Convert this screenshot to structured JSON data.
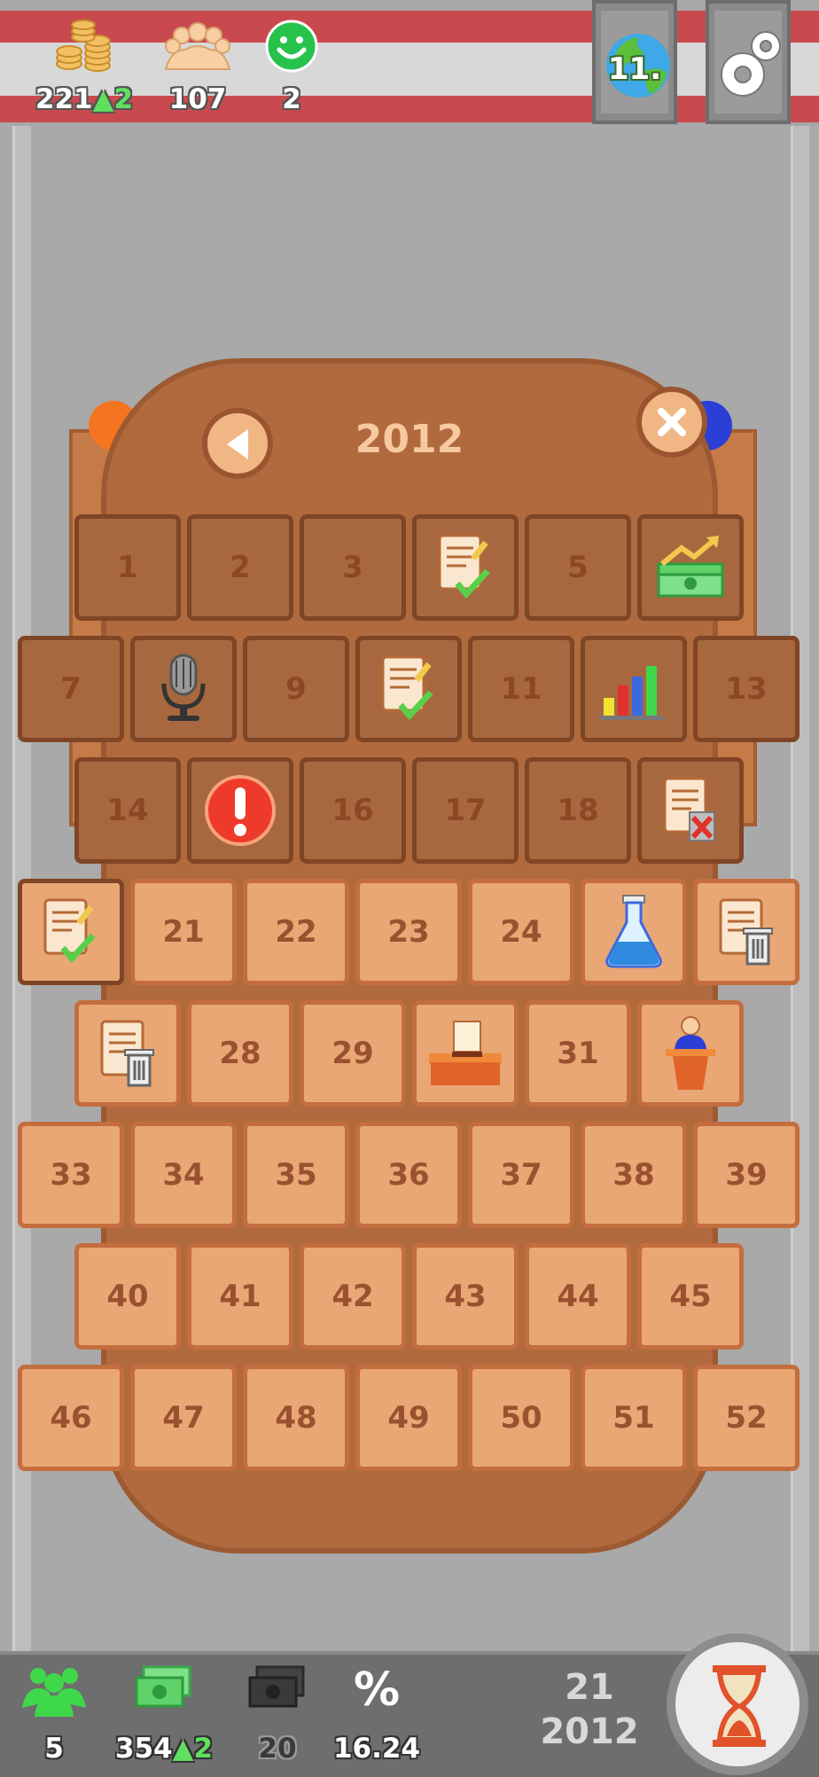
{
  "top_bar": {
    "coins": {
      "value": "221",
      "gain": "2"
    },
    "population": {
      "value": "107"
    },
    "happiness": {
      "value": "2"
    },
    "rank_label": "11.",
    "icons": {
      "coins": "coin-stack-icon",
      "population": "crowd-icon",
      "happiness": "smiley-icon",
      "rank": "globe-icon",
      "settings": "gears-icon"
    }
  },
  "calendar": {
    "year": "2012",
    "back_icon": "left-arrow-icon",
    "close_icon": "close-icon",
    "weeks": [
      {
        "label": "1",
        "state": "past",
        "icon": null
      },
      {
        "label": "2",
        "state": "past",
        "icon": null
      },
      {
        "label": "3",
        "state": "past",
        "icon": null
      },
      {
        "label": "",
        "state": "past",
        "icon": "document-approved-icon"
      },
      {
        "label": "5",
        "state": "past",
        "icon": null
      },
      {
        "label": "",
        "state": "past",
        "icon": "money-growth-icon"
      },
      {
        "label": "7",
        "state": "past",
        "icon": null
      },
      {
        "label": "",
        "state": "past",
        "icon": "microphone-icon"
      },
      {
        "label": "9",
        "state": "past",
        "icon": null
      },
      {
        "label": "",
        "state": "past",
        "icon": "document-approved-icon"
      },
      {
        "label": "11",
        "state": "past",
        "icon": null
      },
      {
        "label": "",
        "state": "past",
        "icon": "bar-chart-icon"
      },
      {
        "label": "13",
        "state": "past",
        "icon": null
      },
      {
        "label": "14",
        "state": "past",
        "icon": null
      },
      {
        "label": "",
        "state": "past",
        "icon": "alert-icon"
      },
      {
        "label": "16",
        "state": "past",
        "icon": null
      },
      {
        "label": "17",
        "state": "past",
        "icon": null
      },
      {
        "label": "18",
        "state": "past",
        "icon": null
      },
      {
        "label": "",
        "state": "past",
        "icon": "document-rejected-icon"
      },
      {
        "label": "",
        "state": "current",
        "icon": "document-approved-icon"
      },
      {
        "label": "21",
        "state": "future",
        "icon": null
      },
      {
        "label": "22",
        "state": "future",
        "icon": null
      },
      {
        "label": "23",
        "state": "future",
        "icon": null
      },
      {
        "label": "24",
        "state": "future",
        "icon": null
      },
      {
        "label": "",
        "state": "future",
        "icon": "flask-icon"
      },
      {
        "label": "",
        "state": "future",
        "icon": "document-trash-icon"
      },
      {
        "label": "",
        "state": "future",
        "icon": "document-trash-icon"
      },
      {
        "label": "28",
        "state": "future",
        "icon": null
      },
      {
        "label": "29",
        "state": "future",
        "icon": null
      },
      {
        "label": "",
        "state": "future",
        "icon": "ballot-box-icon"
      },
      {
        "label": "31",
        "state": "future",
        "icon": null
      },
      {
        "label": "",
        "state": "future",
        "icon": "speaker-podium-icon"
      },
      {
        "label": "33",
        "state": "future",
        "icon": null
      },
      {
        "label": "34",
        "state": "future",
        "icon": null
      },
      {
        "label": "35",
        "state": "future",
        "icon": null
      },
      {
        "label": "36",
        "state": "future",
        "icon": null
      },
      {
        "label": "37",
        "state": "future",
        "icon": null
      },
      {
        "label": "38",
        "state": "future",
        "icon": null
      },
      {
        "label": "39",
        "state": "future",
        "icon": null
      },
      {
        "label": "40",
        "state": "future",
        "icon": null
      },
      {
        "label": "41",
        "state": "future",
        "icon": null
      },
      {
        "label": "42",
        "state": "future",
        "icon": null
      },
      {
        "label": "43",
        "state": "future",
        "icon": null
      },
      {
        "label": "44",
        "state": "future",
        "icon": null
      },
      {
        "label": "45",
        "state": "future",
        "icon": null
      },
      {
        "label": "46",
        "state": "future",
        "icon": null
      },
      {
        "label": "47",
        "state": "future",
        "icon": null
      },
      {
        "label": "48",
        "state": "future",
        "icon": null
      },
      {
        "label": "49",
        "state": "future",
        "icon": null
      },
      {
        "label": "50",
        "state": "future",
        "icon": null
      },
      {
        "label": "51",
        "state": "future",
        "icon": null
      },
      {
        "label": "52",
        "state": "future",
        "icon": null
      }
    ]
  },
  "bottom_bar": {
    "supporters": {
      "value": "5",
      "icon": "people-icon"
    },
    "money": {
      "value": "354",
      "gain": "2",
      "icon": "cash-icon"
    },
    "expenses": {
      "value": "20",
      "icon": "dark-cash-icon"
    },
    "percentage": {
      "value": "16.24",
      "symbol": "%"
    },
    "week": "21",
    "year": "2012",
    "end_turn_icon": "hourglass-icon"
  },
  "colors": {
    "panel": "#b06a3e",
    "tile_past": "#a8683f",
    "tile_future": "#e8a774",
    "stripe_red": "#c94a4e",
    "gain_green": "#5fe05f"
  }
}
